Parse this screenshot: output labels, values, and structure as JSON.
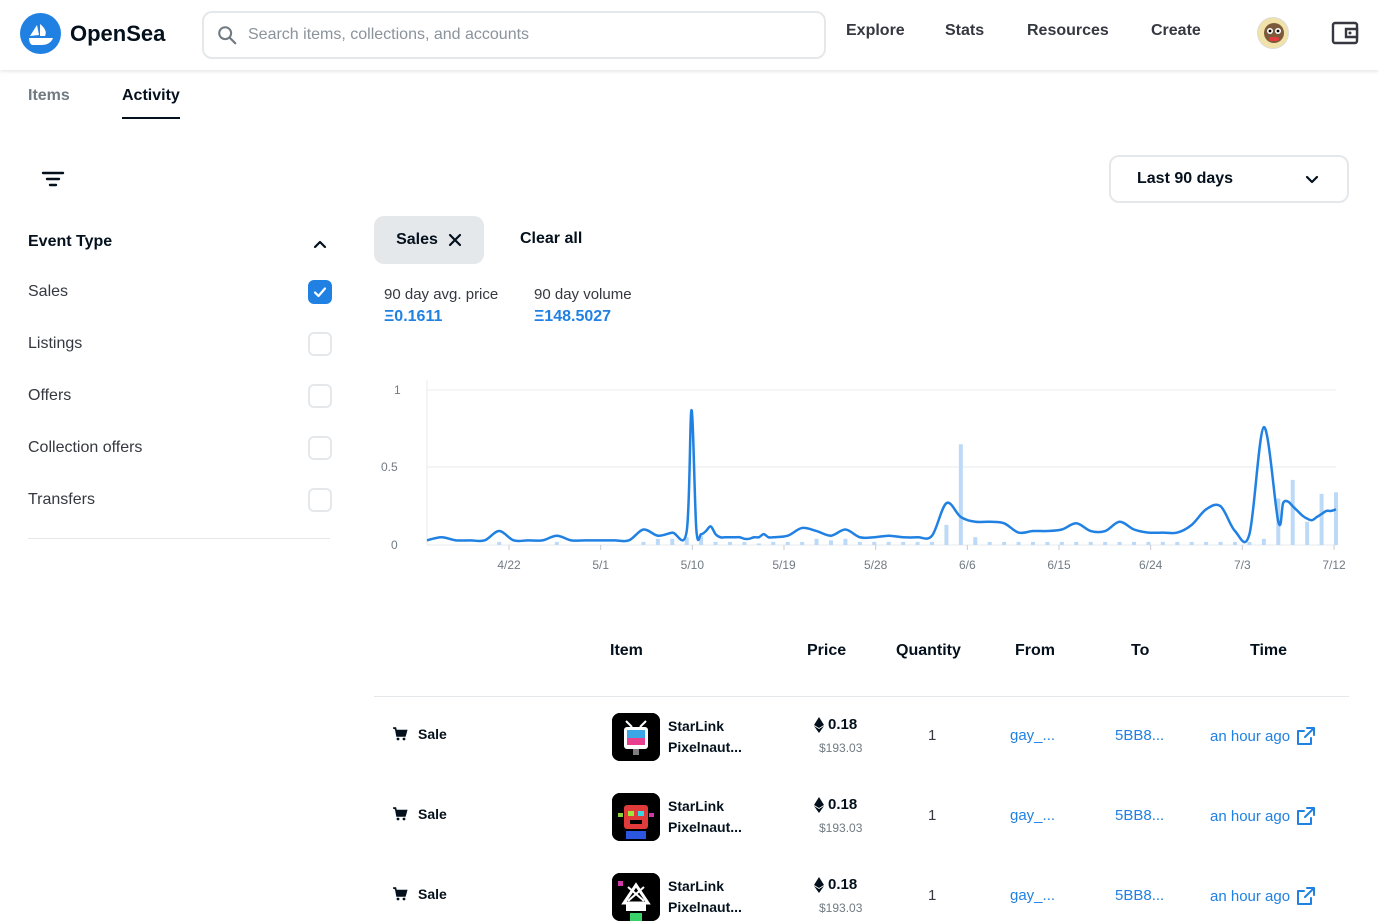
{
  "header": {
    "brand": "OpenSea",
    "search_placeholder": "Search items, collections, and accounts",
    "nav": [
      "Explore",
      "Stats",
      "Resources",
      "Create"
    ]
  },
  "tabs": [
    "Items",
    "Activity"
  ],
  "active_tab": "Activity",
  "filters": {
    "title": "Event Type",
    "items": [
      {
        "label": "Sales",
        "checked": true
      },
      {
        "label": "Listings",
        "checked": false
      },
      {
        "label": "Offers",
        "checked": false
      },
      {
        "label": "Collection offers",
        "checked": false
      },
      {
        "label": "Transfers",
        "checked": false
      }
    ]
  },
  "date_range": "Last 90 days",
  "active_filter": "Sales",
  "clear_all": "Clear all",
  "stats": {
    "avg_label": "90 day avg. price",
    "avg_value": "Ξ0.1611",
    "volume_label": "90 day volume",
    "volume_value": "Ξ148.5027"
  },
  "chart_data": {
    "type": "line",
    "y_ticks": [
      "1",
      "0.5",
      "0"
    ],
    "x_ticks": [
      "4/22",
      "5/1",
      "5/10",
      "5/19",
      "5/28",
      "6/6",
      "6/15",
      "6/24",
      "7/3",
      "7/12"
    ],
    "ylim": [
      0,
      1
    ],
    "grid": true,
    "series": [
      {
        "kind": "line",
        "x": [
          0,
          3,
          6,
          9,
          12,
          15,
          18,
          21,
          24,
          27,
          30,
          33,
          36,
          39,
          42,
          45,
          48,
          51,
          54,
          55,
          56,
          57,
          58,
          59,
          60,
          61,
          62,
          63,
          64,
          65,
          66,
          67,
          68,
          69,
          70,
          71,
          72,
          75,
          78,
          81,
          84,
          87,
          90,
          93,
          96,
          99,
          102,
          105,
          108,
          111,
          114,
          117,
          120,
          123,
          126,
          129,
          132,
          135,
          138,
          141,
          144,
          147,
          150,
          153,
          156,
          159,
          162,
          165,
          168,
          171,
          174,
          177,
          178,
          179,
          180,
          181,
          182,
          183,
          184,
          185,
          186,
          187,
          188,
          189
        ],
        "y": [
          0.03,
          0.05,
          0.03,
          0.03,
          0.03,
          0.09,
          0.03,
          0.03,
          0.03,
          0.06,
          0.03,
          0.03,
          0.03,
          0.03,
          0.03,
          0.1,
          0.06,
          0.08,
          0.09,
          0.87,
          0.1,
          0.07,
          0.09,
          0.12,
          0.07,
          0.05,
          0.05,
          0.05,
          0.05,
          0.05,
          0.04,
          0.04,
          0.05,
          0.05,
          0.07,
          0.05,
          0.05,
          0.06,
          0.11,
          0.09,
          0.06,
          0.1,
          0.05,
          0.05,
          0.06,
          0.05,
          0.05,
          0.06,
          0.27,
          0.18,
          0.15,
          0.15,
          0.14,
          0.08,
          0.09,
          0.09,
          0.1,
          0.14,
          0.09,
          0.09,
          0.15,
          0.1,
          0.08,
          0.08,
          0.08,
          0.13,
          0.23,
          0.25,
          0.09,
          0.07,
          0.76,
          0.15,
          0.27,
          0.28,
          0.25,
          0.22,
          0.19,
          0.17,
          0.16,
          0.18,
          0.2,
          0.22,
          0.22,
          0.23
        ]
      },
      {
        "kind": "bar",
        "x": [
          15,
          27,
          45,
          48,
          51,
          54,
          57,
          60,
          63,
          66,
          69,
          72,
          75,
          78,
          81,
          84,
          87,
          90,
          93,
          96,
          99,
          102,
          105,
          108,
          111,
          114,
          117,
          120,
          123,
          126,
          129,
          132,
          135,
          138,
          141,
          144,
          147,
          150,
          153,
          156,
          159,
          162,
          165,
          168,
          171,
          174,
          177,
          180,
          183,
          186,
          189
        ],
        "y": [
          0.02,
          0.02,
          0.02,
          0.04,
          0.04,
          0.05,
          0.06,
          0.02,
          0.02,
          0.02,
          0.01,
          0.02,
          0.02,
          0.02,
          0.04,
          0.03,
          0.04,
          0.02,
          0.02,
          0.02,
          0.02,
          0.02,
          0.02,
          0.13,
          0.65,
          0.05,
          0.02,
          0.02,
          0.02,
          0.02,
          0.02,
          0.02,
          0.02,
          0.02,
          0.02,
          0.02,
          0.02,
          0.02,
          0.02,
          0.02,
          0.02,
          0.02,
          0.02,
          0.02,
          0.02,
          0.04,
          0.3,
          0.42,
          0.15,
          0.33,
          0.34
        ]
      }
    ]
  },
  "table": {
    "columns": [
      "Item",
      "Price",
      "Quantity",
      "From",
      "To",
      "Time"
    ],
    "rows": [
      {
        "event": "Sale",
        "item_line1": "StarLink",
        "item_line2": "Pixelnaut...",
        "price": "0.18",
        "usd": "$193.03",
        "qty": "1",
        "from": "gay_...",
        "to": "5BB8...",
        "time": "an hour ago"
      },
      {
        "event": "Sale",
        "item_line1": "StarLink",
        "item_line2": "Pixelnaut...",
        "price": "0.18",
        "usd": "$193.03",
        "qty": "1",
        "from": "gay_...",
        "to": "5BB8...",
        "time": "an hour ago"
      },
      {
        "event": "Sale",
        "item_line1": "StarLink",
        "item_line2": "Pixelnaut...",
        "price": "0.18",
        "usd": "$193.03",
        "qty": "1",
        "from": "gay_...",
        "to": "5BB8...",
        "time": "an hour ago"
      }
    ]
  },
  "colors": {
    "accent": "#2081e2",
    "bar": "#bcdaf7",
    "text": "#04111d"
  }
}
